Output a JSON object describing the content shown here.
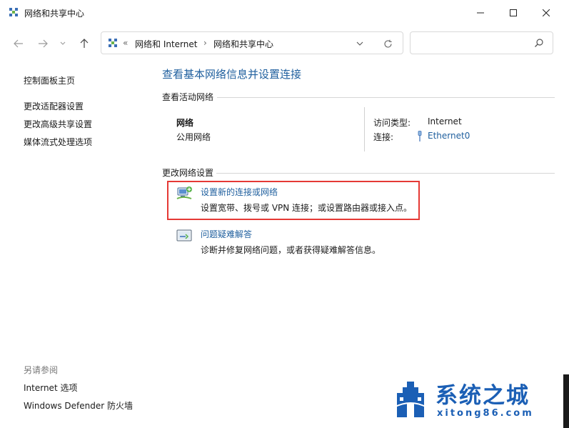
{
  "window": {
    "title": "网络和共享中心"
  },
  "address": {
    "overflow": "«",
    "crumbs": [
      "网络和 Internet",
      "网络和共享中心"
    ],
    "separator": "›"
  },
  "search": {
    "placeholder": ""
  },
  "left_pane": {
    "links": [
      "控制面板主页",
      "更改适配器设置",
      "更改高级共享设置",
      "媒体流式处理选项"
    ],
    "see_also_title": "另请参阅",
    "see_also_links": [
      "Internet 选项",
      "Windows Defender 防火墙"
    ]
  },
  "main": {
    "title": "查看基本网络信息并设置连接",
    "active_networks_label": "查看活动网络",
    "network": {
      "name": "网络",
      "type": "公用网络",
      "access_type_label": "访问类型:",
      "access_type_value": "Internet",
      "connection_label": "连接:",
      "connection_value": "Ethernet0"
    },
    "change_settings_label": "更改网络设置",
    "tasks": [
      {
        "link": "设置新的连接或网络",
        "description": "设置宽带、拨号或 VPN 连接；或设置路由器或接入点。"
      },
      {
        "link": "问题疑难解答",
        "description": "诊断并修复网络问题，或者获得疑难解答信息。"
      }
    ]
  },
  "watermark": {
    "title": "系统之城",
    "url": "xitong86.com"
  },
  "colors": {
    "link": "#1f5f9e",
    "highlight_border": "#e53935",
    "watermark": "#1b5fb5"
  },
  "icons": {
    "app": "network-icon",
    "back": "arrow-left-icon",
    "forward": "arrow-right-icon",
    "recent": "chevron-down-icon",
    "up": "arrow-up-icon",
    "refresh": "refresh-icon",
    "search": "search-icon",
    "minimize": "minimize-icon",
    "maximize": "maximize-icon",
    "close": "close-icon"
  }
}
